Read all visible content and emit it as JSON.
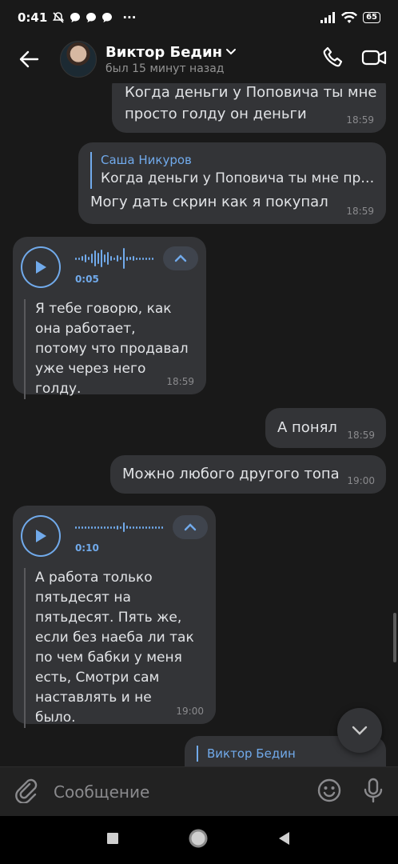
{
  "status_bar": {
    "time": "0:41",
    "dots": "···",
    "battery": "65"
  },
  "header": {
    "name": "Виктор Бедин",
    "last_seen": "был 15 минут назад"
  },
  "messages": [
    {
      "text": "Когда деньги у Поповича ты мне просто голду он деньги",
      "time": "18:59"
    },
    {
      "reply_author": "Саша Никуров",
      "reply_text": "Когда деньги у Поповича ты мне про...",
      "text": "Могу дать скрин как я покупал",
      "time": "18:59"
    },
    {
      "voice_duration": "0:05",
      "transcript": "Я тебе говорю, как она работает, потому что продавал уже через него голду.",
      "time": "18:59"
    },
    {
      "text": "А понял",
      "time": "18:59"
    },
    {
      "text": "Можно любого другого топа",
      "time": "19:00"
    },
    {
      "voice_duration": "0:10",
      "transcript": "А работа только пятьдесят на пятьдесят. Пять же, если без наеба ли так по чем бабки у меня есть, Смотри сам наставлять и не было.",
      "time": "19:00"
    },
    {
      "reply_author": "Виктор Бедин"
    }
  ],
  "composer": {
    "placeholder": "Сообщение"
  },
  "icons": {
    "back": "arrow-left-icon",
    "dropdown": "chevron-down-icon",
    "call": "phone-icon",
    "video": "video-camera-icon",
    "play": "play-icon",
    "expand": "chevron-up-icon",
    "scroll": "chevron-down-icon",
    "attach": "paperclip-icon",
    "emoji": "smile-icon",
    "mic": "microphone-icon",
    "nav_recents": "square-icon",
    "nav_home": "circle-icon",
    "nav_back": "triangle-icon"
  },
  "colors": {
    "background": "#191919",
    "bubble": "#333437",
    "accent": "#71aaeb",
    "muted": "#8a8a8d"
  }
}
